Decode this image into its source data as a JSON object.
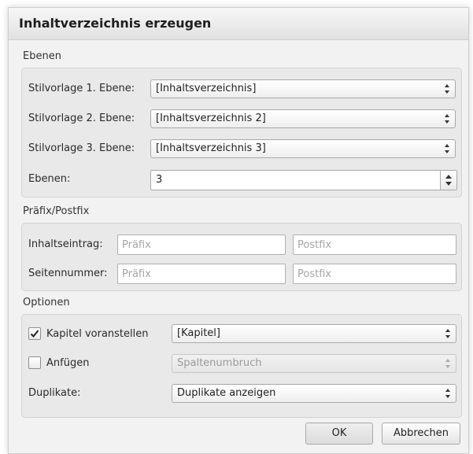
{
  "dialog": {
    "title": "Inhaltverzeichnis erzeugen"
  },
  "ebenen": {
    "section_label": "Ebenen",
    "rows": [
      {
        "label": "Stilvorlage 1. Ebene:",
        "value": "[Inhaltsverzeichnis]"
      },
      {
        "label": "Stilvorlage 2. Ebene:",
        "value": "[Inhaltsverzeichnis 2]"
      },
      {
        "label": "Stilvorlage 3. Ebene:",
        "value": "[Inhaltsverzeichnis 3]"
      }
    ],
    "levels_label": "Ebenen:",
    "levels_value": "3"
  },
  "prefix_postfix": {
    "section_label": "Präfix/Postfix",
    "rows": [
      {
        "label": "Inhaltseintrag:",
        "prefix_placeholder": "Präfix",
        "postfix_placeholder": "Postfix"
      },
      {
        "label": "Seitennummer:",
        "prefix_placeholder": "Präfix",
        "postfix_placeholder": "Postfix"
      }
    ]
  },
  "optionen": {
    "section_label": "Optionen",
    "kapitel": {
      "label": "Kapitel voranstellen",
      "checked": true,
      "value": "[Kapitel]"
    },
    "anfuegen": {
      "label": "Anfügen",
      "checked": false,
      "value": "Spaltenumbruch"
    },
    "duplikate": {
      "label": "Duplikate:",
      "value": "Duplikate anzeigen"
    }
  },
  "buttons": {
    "ok": "OK",
    "cancel": "Abbrechen"
  },
  "icons": {
    "select_arrows": "up-down-arrows-icon",
    "checkmark": "checkmark-icon"
  }
}
